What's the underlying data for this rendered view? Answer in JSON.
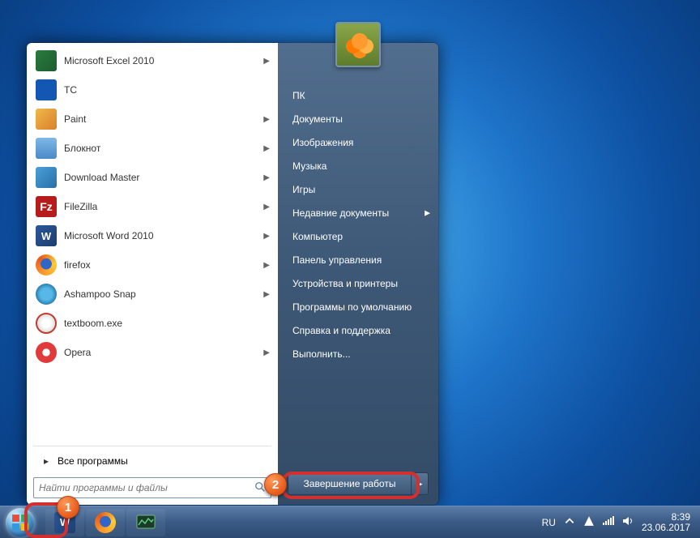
{
  "start_menu": {
    "programs": [
      {
        "icon": "excel-icon",
        "label": "Microsoft Excel 2010",
        "has_submenu": true
      },
      {
        "icon": "tc-icon",
        "label": "TC",
        "has_submenu": false
      },
      {
        "icon": "paint-icon",
        "label": "Paint",
        "has_submenu": true
      },
      {
        "icon": "notepad-icon",
        "label": "Блокнот",
        "has_submenu": true
      },
      {
        "icon": "download-master-icon",
        "label": "Download Master",
        "has_submenu": true
      },
      {
        "icon": "filezilla-icon",
        "label": "FileZilla",
        "has_submenu": true
      },
      {
        "icon": "word-icon",
        "label": "Microsoft Word 2010",
        "has_submenu": true
      },
      {
        "icon": "firefox-icon",
        "label": "firefox",
        "has_submenu": true
      },
      {
        "icon": "ashampoo-icon",
        "label": "Ashampoo Snap",
        "has_submenu": true
      },
      {
        "icon": "textboom-icon",
        "label": "textboom.exe",
        "has_submenu": false
      },
      {
        "icon": "opera-icon",
        "label": "Opera",
        "has_submenu": true
      }
    ],
    "all_programs": "Все программы",
    "search_placeholder": "Найти программы и файлы",
    "right_items": [
      {
        "label": "ПК",
        "has_submenu": false
      },
      {
        "label": "Документы",
        "has_submenu": false
      },
      {
        "label": "Изображения",
        "has_submenu": false
      },
      {
        "label": "Музыка",
        "has_submenu": false
      },
      {
        "label": "Игры",
        "has_submenu": false
      },
      {
        "label": "Недавние документы",
        "has_submenu": true
      },
      {
        "label": "Компьютер",
        "has_submenu": false
      },
      {
        "label": "Панель управления",
        "has_submenu": false
      },
      {
        "label": "Устройства и принтеры",
        "has_submenu": false
      },
      {
        "label": "Программы по умолчанию",
        "has_submenu": false
      },
      {
        "label": "Справка и поддержка",
        "has_submenu": false
      },
      {
        "label": "Выполнить...",
        "has_submenu": false
      }
    ],
    "shutdown_label": "Завершение работы"
  },
  "taskbar": {
    "pinned": [
      {
        "icon": "word-icon"
      },
      {
        "icon": "firefox-icon"
      },
      {
        "icon": "task-manager-icon"
      }
    ],
    "lang": "RU",
    "time": "8:39",
    "date": "23.06.2017"
  },
  "annotations": {
    "badge1": "1",
    "badge2": "2"
  }
}
